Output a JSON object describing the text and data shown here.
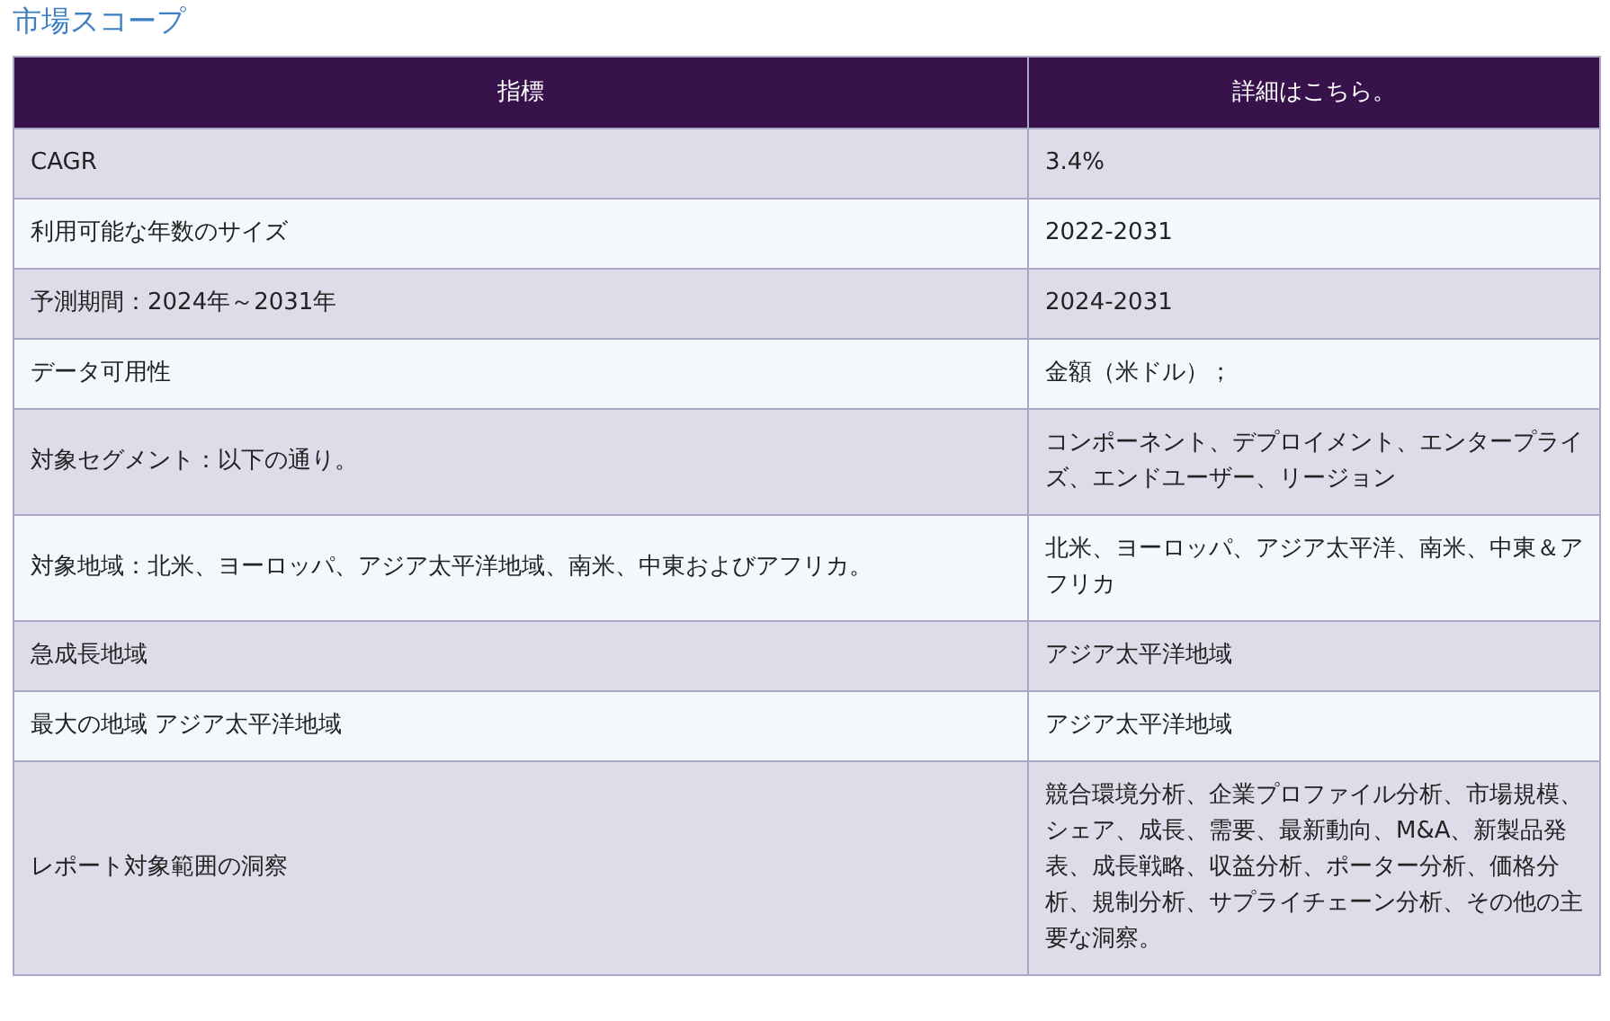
{
  "title": "市場スコープ",
  "table": {
    "columns": [
      "指標",
      "詳細はこちら。"
    ],
    "rows": [
      [
        "CAGR",
        "3.4%"
      ],
      [
        "利用可能な年数のサイズ",
        "2022-2031"
      ],
      [
        "予測期間：2024年～2031年",
        "2024-2031"
      ],
      [
        "データ可用性",
        "金額（米ドル）；"
      ],
      [
        "対象セグメント：以下の通り。",
        "コンポーネント、デプロイメント、エンタープライズ、エンドユーザー、リージョン"
      ],
      [
        "対象地域：北米、ヨーロッパ、アジア太平洋地域、南米、中東およびアフリカ。",
        "北米、ヨーロッパ、アジア太平洋、南米、中東＆アフリカ"
      ],
      [
        "急成長地域",
        "アジア太平洋地域"
      ],
      [
        "最大の地域 アジア太平洋地域",
        "アジア太平洋地域"
      ],
      [
        "レポート対象範囲の洞察",
        "競合環境分析、企業プロファイル分析、市場規模、シェア、成長、需要、最新動向、M&A、新製品発表、成長戦略、収益分析、ポーター分析、価格分析、規制分析、サプライチェーン分析、その他の主要な洞察。"
      ]
    ]
  }
}
